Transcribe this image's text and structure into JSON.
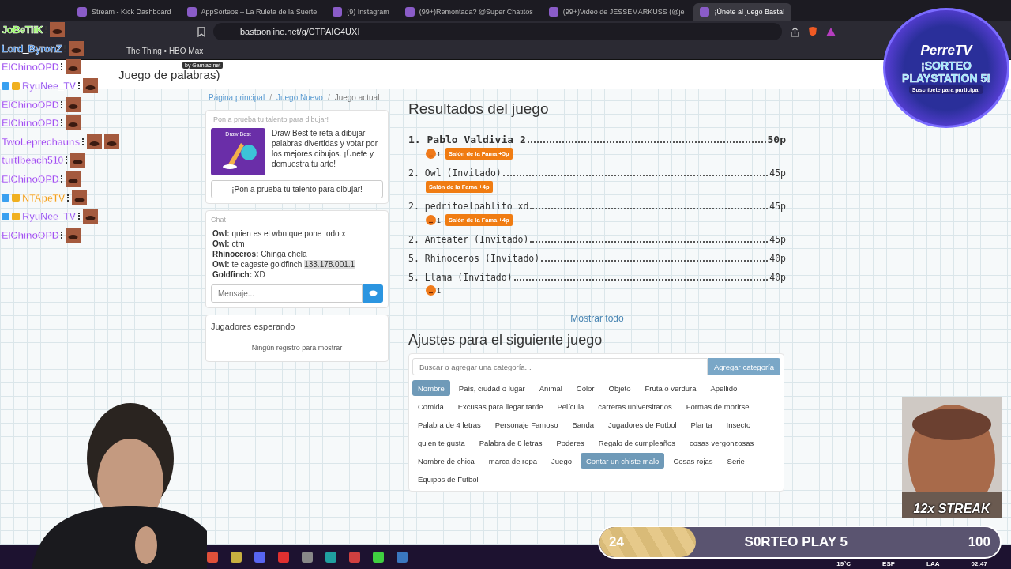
{
  "browser": {
    "tabs": [
      {
        "label": "Stream - Kick Dashboard",
        "selected": false
      },
      {
        "label": "AppSorteos – La Ruleta de la Suerte",
        "selected": false
      },
      {
        "label": "(9) Instagram",
        "selected": false
      },
      {
        "label": "(99+)Remontada? @Super Chatitos",
        "selected": false
      },
      {
        "label": "(99+)Video de JESSEMARKUSS (@je",
        "selected": false
      },
      {
        "label": "¡Únete al juego Basta!",
        "selected": true
      }
    ],
    "address": "bastaonline.net/g/CTPAIG4UXI",
    "bookmarks": [
      "The Thing • HBO Max"
    ]
  },
  "page": {
    "credit": "by Gamiac.net",
    "title_end": "Juego de palabras)",
    "separator": "/",
    "breadcrumbs": [
      {
        "label": "Página principal",
        "kind": "link"
      },
      {
        "label": "Juego Nuevo",
        "kind": "link"
      },
      {
        "label": "Juego actual",
        "kind": "current"
      }
    ],
    "promo": {
      "heading": "¡Pon a prueba tu talento para dibujar!",
      "art_label": "Draw Best",
      "text": "Draw Best te reta a dibujar palabras divertidas y votar por los mejores dibujos. ¡Únete y demuestra tu arte!",
      "button": "¡Pon a prueba tu talento para dibujar!"
    },
    "chat": {
      "heading": "Chat",
      "messages": [
        {
          "author": "Owl:",
          "text": "quien es el wbn que pone todo x"
        },
        {
          "author": "Owl:",
          "text": "ctm"
        },
        {
          "author": "Rhinoceros:",
          "text": "Chinga chela"
        },
        {
          "author": "Owl:",
          "text": "te cagaste goldfinch",
          "highlight": "133.178.001.1"
        },
        {
          "author": "Goldfinch:",
          "text": "XD"
        }
      ],
      "placeholder": "Mensaje..."
    },
    "waiting": {
      "heading": "Jugadores esperando",
      "empty": "Ningún registro para mostrar"
    },
    "results": {
      "heading": "Resultados del juego",
      "rows": [
        {
          "rank": "1.",
          "name": "Pablo Valdivia 2",
          "score": "50p",
          "winner": true,
          "angry": "1",
          "fame": "Salón de la Fama +5p"
        },
        {
          "rank": "2.",
          "name": "Owl (Invitado)",
          "score": "45p",
          "winner": false,
          "fame": "Salón de la Fama +4p"
        },
        {
          "rank": "2.",
          "name": "pedritoelpablito xd",
          "score": "45p",
          "winner": false,
          "angry": "1",
          "fame": "Salón de la Fama +4p"
        },
        {
          "rank": "2.",
          "name": "Anteater (Invitado)",
          "score": "45p",
          "winner": false
        },
        {
          "rank": "5.",
          "name": "Rhinoceros (Invitado)",
          "score": "40p",
          "winner": false
        },
        {
          "rank": "5.",
          "name": "Llama (Invitado)",
          "score": "40p",
          "winner": false,
          "angry": "1"
        }
      ],
      "show_all": "Mostrar todo"
    },
    "settings": {
      "heading": "Ajustes para el siguiente juego",
      "placeholder": "Buscar o agregar una categoría...",
      "add_button": "Agregar categoría",
      "categories": [
        {
          "label": "Nombre",
          "selected": true
        },
        {
          "label": "País, ciudad o lugar",
          "selected": false
        },
        {
          "label": "Animal",
          "selected": false
        },
        {
          "label": "Color",
          "selected": false
        },
        {
          "label": "Objeto",
          "selected": false
        },
        {
          "label": "Fruta o verdura",
          "selected": false
        },
        {
          "label": "Apellido",
          "selected": false
        },
        {
          "label": "Comida",
          "selected": false
        },
        {
          "label": "Excusas para llegar tarde",
          "selected": false
        },
        {
          "label": "Película",
          "selected": false
        },
        {
          "label": "carreras universitarios",
          "selected": false
        },
        {
          "label": "Formas de morirse",
          "selected": false
        },
        {
          "label": "Palabra de 4 letras",
          "selected": false
        },
        {
          "label": "Personaje Famoso",
          "selected": false
        },
        {
          "label": "Banda",
          "selected": false
        },
        {
          "label": "Jugadores de Futbol",
          "selected": false
        },
        {
          "label": "Planta",
          "selected": false
        },
        {
          "label": "Insecto",
          "selected": false
        },
        {
          "label": "quien te gusta",
          "selected": false
        },
        {
          "label": "Palabra de 8 letras",
          "selected": false
        },
        {
          "label": "Poderes",
          "selected": false
        },
        {
          "label": "Regalo de cumpleaños",
          "selected": false
        },
        {
          "label": "cosas vergonzosas",
          "selected": false
        },
        {
          "label": "Nombre de chica",
          "selected": false
        },
        {
          "label": "marca de ropa",
          "selected": false
        },
        {
          "label": "Juego",
          "selected": false
        },
        {
          "label": "Contar un chiste malo",
          "selected": true
        },
        {
          "label": "Cosas rojas",
          "selected": false
        },
        {
          "label": "Serie",
          "selected": false
        },
        {
          "label": "Equipos de Futbol",
          "selected": false
        }
      ]
    }
  },
  "stream_chat": [
    {
      "user": "JoBeTiiK",
      "color": "#7cfc3c",
      "badges": false
    },
    {
      "user": "Lord_ByronZ",
      "color": "#2f7fe0",
      "badges": false
    },
    {
      "user": "ElChinoOPD",
      "color": "#a050f0",
      "badges": false
    },
    {
      "user": "RyuNee_TV",
      "color": "#9a5cf0",
      "badges": true
    },
    {
      "user": "ElChinoOPD",
      "color": "#a050f0",
      "badges": false
    },
    {
      "user": "ElChinoOPD",
      "color": "#a050f0",
      "badges": false
    },
    {
      "user": "TwoLeprechauns",
      "color": "#a050f0",
      "badges": false,
      "double_emote": true
    },
    {
      "user": "turtlbeach510",
      "color": "#a050f0",
      "badges": false
    },
    {
      "user": "ElChinoOPD",
      "color": "#a050f0",
      "badges": false
    },
    {
      "user": "NTApeTV",
      "color": "#f0a020",
      "badges": true
    },
    {
      "user": "RyuNee_TV",
      "color": "#9a5cf0",
      "badges": true
    },
    {
      "user": "ElChinoOPD",
      "color": "#a050f0",
      "badges": false
    }
  ],
  "giveaway_badge": {
    "brand": "PerreTV",
    "title_1": "¡SORTEO",
    "title_2": "PLAYSTATION 5!",
    "subtitle": "Suscríbete para participar"
  },
  "meme_cam": {
    "caption": "12x STREAK"
  },
  "goal_bar": {
    "current": "24",
    "title": "S0RTEO PLAY 5",
    "target": "100",
    "level": 0.24
  },
  "taskbar": {
    "weather": "19°C",
    "language": "ESP",
    "layout": "LAA",
    "time": "02:47"
  }
}
